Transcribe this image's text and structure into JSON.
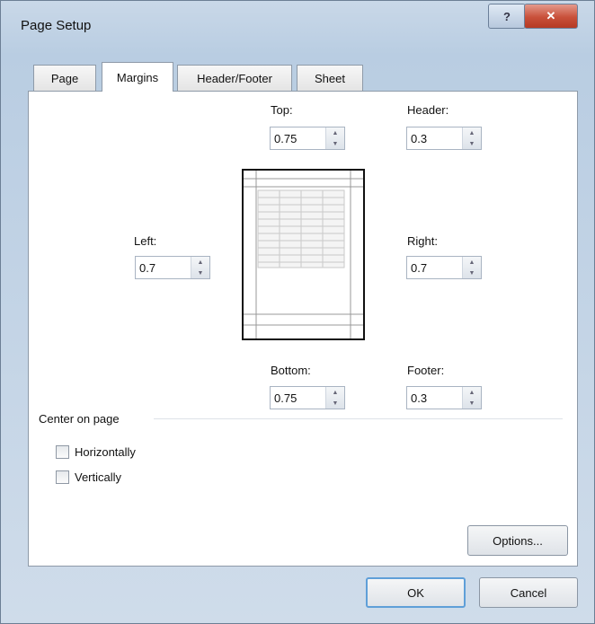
{
  "window": {
    "title": "Page Setup"
  },
  "tabs": [
    {
      "label": "Page"
    },
    {
      "label": "Margins"
    },
    {
      "label": "Header/Footer"
    },
    {
      "label": "Sheet"
    }
  ],
  "margins": {
    "top": {
      "label": "Top:",
      "value": "0.75"
    },
    "header": {
      "label": "Header:",
      "value": "0.3"
    },
    "left": {
      "label": "Left:",
      "value": "0.7"
    },
    "right": {
      "label": "Right:",
      "value": "0.7"
    },
    "bottom": {
      "label": "Bottom:",
      "value": "0.75"
    },
    "footer": {
      "label": "Footer:",
      "value": "0.3"
    }
  },
  "center_on_page": {
    "title": "Center on page",
    "horizontally": {
      "label": "Horizontally",
      "checked": false
    },
    "vertically": {
      "label": "Vertically",
      "checked": false
    }
  },
  "buttons": {
    "options": "Options...",
    "ok": "OK",
    "cancel": "Cancel"
  }
}
